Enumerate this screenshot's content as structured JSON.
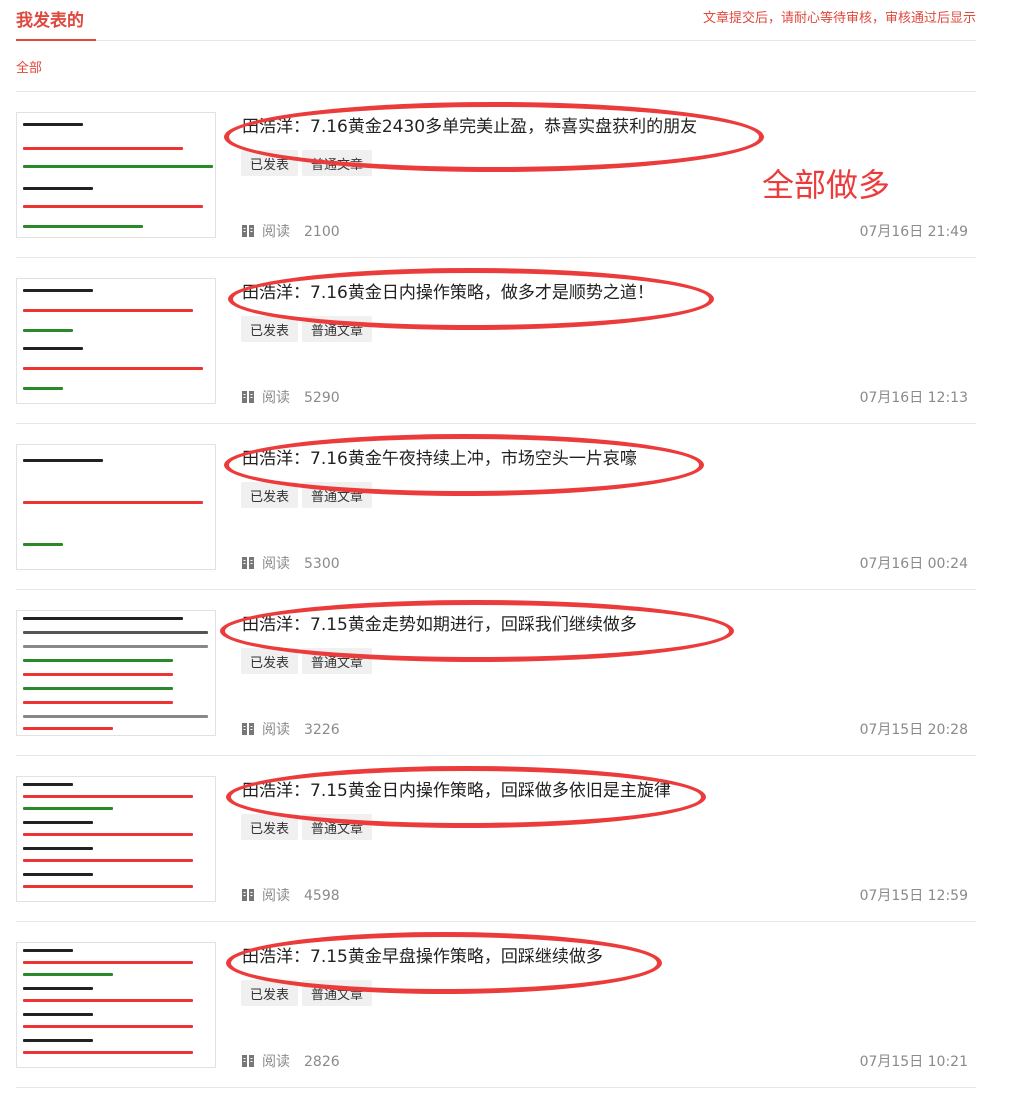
{
  "header": {
    "title": "我发表的",
    "notice": "文章提交后，请耐心等待审核，审核通过后显示"
  },
  "filter": {
    "all_label": "全部"
  },
  "annotation": "全部做多",
  "read_label": "阅读",
  "articles": [
    {
      "title": "田浩洋：7.16黄金2430多单完美止盈，恭喜实盘获利的朋友",
      "status_tag": "已发表",
      "type_tag": "普通文章",
      "reads": "2100",
      "date": "07月16日 21:49"
    },
    {
      "title": "田浩洋：7.16黄金日内操作策略，做多才是顺势之道！",
      "status_tag": "已发表",
      "type_tag": "普通文章",
      "reads": "5290",
      "date": "07月16日 12:13"
    },
    {
      "title": "田浩洋：7.16黄金午夜持续上冲，市场空头一片哀嚎",
      "status_tag": "已发表",
      "type_tag": "普通文章",
      "reads": "5300",
      "date": "07月16日 00:24"
    },
    {
      "title": "田浩洋：7.15黄金走势如期进行，回踩我们继续做多",
      "status_tag": "已发表",
      "type_tag": "普通文章",
      "reads": "3226",
      "date": "07月15日 20:28"
    },
    {
      "title": "田浩洋：7.15黄金日内操作策略，回踩做多依旧是主旋律",
      "status_tag": "已发表",
      "type_tag": "普通文章",
      "reads": "4598",
      "date": "07月15日 12:59"
    },
    {
      "title": "田浩洋：7.15黄金早盘操作策略，回踩继续做多",
      "status_tag": "已发表",
      "type_tag": "普通文章",
      "reads": "2826",
      "date": "07月15日 10:21"
    }
  ],
  "colors": {
    "accent": "#e1483d",
    "annotation": "#ec3b3b"
  }
}
